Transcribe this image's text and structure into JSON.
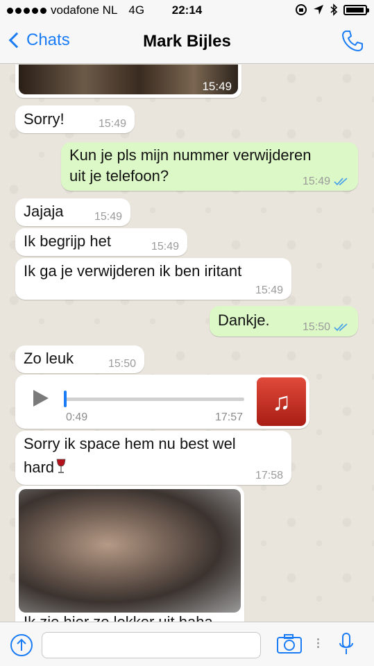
{
  "status_bar": {
    "carrier": "vodafone NL",
    "network": "4G",
    "time": "22:14"
  },
  "nav": {
    "back_label": "Chats",
    "title": "Mark Bijles",
    "call_icon": "phone-icon"
  },
  "messages": [
    {
      "type": "image",
      "direction": "in",
      "time": "15:49"
    },
    {
      "type": "text",
      "direction": "in",
      "text": "Sorry!",
      "time": "15:49"
    },
    {
      "type": "text",
      "direction": "out",
      "text": "Kun je pls mijn nummer verwijderen\nuit je telefoon?",
      "time": "15:49",
      "status": "read"
    },
    {
      "type": "text",
      "direction": "in",
      "text": "Jajaja",
      "time": "15:49"
    },
    {
      "type": "text",
      "direction": "in",
      "text": "Ik begrijp het",
      "time": "15:49"
    },
    {
      "type": "text",
      "direction": "in",
      "text": "Ik ga je verwijderen ik ben iritant",
      "time": "15:49"
    },
    {
      "type": "text",
      "direction": "out",
      "text": "Dankje.",
      "time": "15:50",
      "status": "read"
    },
    {
      "type": "text",
      "direction": "in",
      "text": "Zo leuk",
      "time": "15:50"
    },
    {
      "type": "audio",
      "direction": "in",
      "position": "0:49",
      "time": "17:57"
    },
    {
      "type": "text",
      "direction": "in",
      "text": "Sorry ik space hem nu best wel\nhard",
      "time": "17:58"
    },
    {
      "type": "image",
      "direction": "in",
      "caption": "Ik zie hier zo lekker uit haha"
    }
  ],
  "colors": {
    "incoming": "#ffffff",
    "outgoing": "#dcf8c6",
    "accent": "#1a7cf5",
    "background": "#e9e5dc"
  }
}
